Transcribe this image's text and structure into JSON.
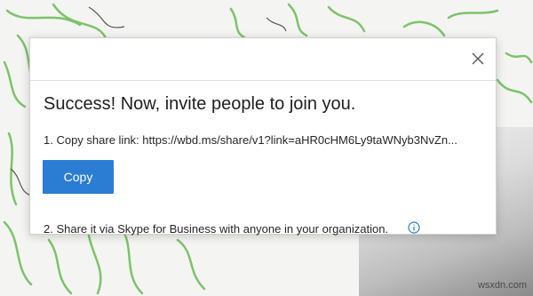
{
  "dialog": {
    "title": "Success! Now, invite people to join you.",
    "step1": "1. Copy share link: https://wbd.ms/share/v1?link=aHR0cHM6Ly9taWNyb3NvZn...",
    "copy_button_label": "Copy",
    "step2": "2. Share it via Skype for Business with anyone in your organization.",
    "icons": [
      "close-icon",
      "info-icon"
    ]
  },
  "watermark": "wsxdn.com",
  "colors": {
    "accent": "#2b7cd3",
    "sketch": "#7cc36a",
    "text": "#262626"
  }
}
